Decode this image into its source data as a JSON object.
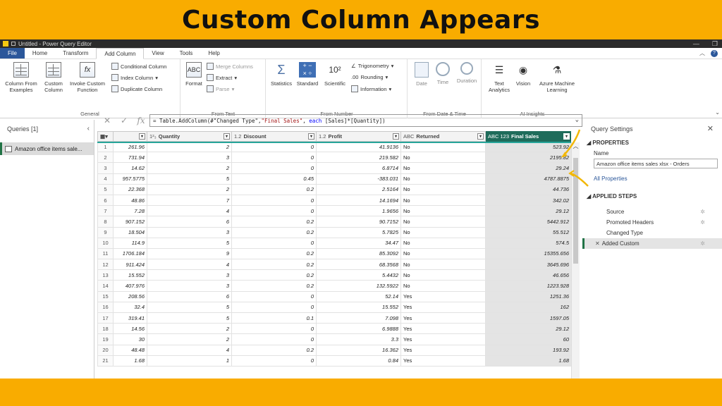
{
  "banner": {
    "title": "Custom Column Appears"
  },
  "window": {
    "title": "Untitled - Power Query Editor"
  },
  "menu": {
    "tabs": [
      "File",
      "Home",
      "Transform",
      "Add Column",
      "View",
      "Tools",
      "Help"
    ],
    "active": "Add Column"
  },
  "ribbon": {
    "general": {
      "label": "General",
      "column_from_examples": "Column From Examples",
      "custom_column": "Custom Column",
      "invoke_custom_function": "Invoke Custom Function",
      "conditional_column": "Conditional Column",
      "index_column": "Index Column",
      "duplicate_column": "Duplicate Column"
    },
    "from_text": {
      "label": "From Text",
      "format": "Format",
      "merge_columns": "Merge Columns",
      "extract": "Extract",
      "parse": "Parse"
    },
    "from_number": {
      "label": "From Number",
      "statistics": "Statistics",
      "standard": "Standard",
      "scientific": "Scientific",
      "trigonometry": "Trigonometry",
      "rounding": "Rounding",
      "information": "Information"
    },
    "from_date_time": {
      "label": "From Date & Time",
      "date": "Date",
      "time": "Time",
      "duration": "Duration"
    },
    "ai_insights": {
      "label": "AI Insights",
      "text_analytics": "Text Analytics",
      "vision": "Vision",
      "azure_ml": "Azure Machine Learning"
    }
  },
  "queries": {
    "header": "Queries [1]",
    "items": [
      "Amazon office items sale..."
    ]
  },
  "formula": {
    "prefix": "= Table.AddColumn(#\"Changed Type\", ",
    "str": "\"Final Sales\"",
    "mid": ", ",
    "kw": "each",
    "suffix": " [Sales]*[Quantity])"
  },
  "table": {
    "columns": [
      {
        "type": "",
        "name": ""
      },
      {
        "type": "1²₃",
        "name": "Quantity"
      },
      {
        "type": "1.2",
        "name": "Discount"
      },
      {
        "type": "1.2",
        "name": "Profit"
      },
      {
        "type": "ABC",
        "name": "Returned"
      },
      {
        "type": "ABC 123",
        "name": "Final Sales"
      }
    ],
    "rows": [
      [
        "1",
        "261.96",
        "2",
        "0",
        "41.9136",
        "No",
        "523.92"
      ],
      [
        "2",
        "731.94",
        "3",
        "0",
        "219.582",
        "No",
        "2195.82"
      ],
      [
        "3",
        "14.62",
        "2",
        "0",
        "6.8714",
        "No",
        "29.24"
      ],
      [
        "4",
        "957.5775",
        "5",
        "0.45",
        "-383.031",
        "No",
        "4787.8875"
      ],
      [
        "5",
        "22.368",
        "2",
        "0.2",
        "2.5164",
        "No",
        "44.736"
      ],
      [
        "6",
        "48.86",
        "7",
        "0",
        "14.1694",
        "No",
        "342.02"
      ],
      [
        "7",
        "7.28",
        "4",
        "0",
        "1.9656",
        "No",
        "29.12"
      ],
      [
        "8",
        "907.152",
        "6",
        "0.2",
        "90.7152",
        "No",
        "5442.912"
      ],
      [
        "9",
        "18.504",
        "3",
        "0.2",
        "5.7825",
        "No",
        "55.512"
      ],
      [
        "10",
        "114.9",
        "5",
        "0",
        "34.47",
        "No",
        "574.5"
      ],
      [
        "11",
        "1706.184",
        "9",
        "0.2",
        "85.3092",
        "No",
        "15355.656"
      ],
      [
        "12",
        "911.424",
        "4",
        "0.2",
        "68.3568",
        "No",
        "3645.696"
      ],
      [
        "13",
        "15.552",
        "3",
        "0.2",
        "5.4432",
        "No",
        "46.656"
      ],
      [
        "14",
        "407.976",
        "3",
        "0.2",
        "132.5922",
        "No",
        "1223.928"
      ],
      [
        "15",
        "208.56",
        "6",
        "0",
        "52.14",
        "Yes",
        "1251.36"
      ],
      [
        "16",
        "32.4",
        "5",
        "0",
        "15.552",
        "Yes",
        "162"
      ],
      [
        "17",
        "319.41",
        "5",
        "0.1",
        "7.098",
        "Yes",
        "1597.05"
      ],
      [
        "18",
        "14.56",
        "2",
        "0",
        "6.9888",
        "Yes",
        "29.12"
      ],
      [
        "19",
        "30",
        "2",
        "0",
        "3.3",
        "Yes",
        "60"
      ],
      [
        "20",
        "48.48",
        "4",
        "0.2",
        "16.362",
        "Yes",
        "193.92"
      ],
      [
        "21",
        "1.68",
        "1",
        "0",
        "0.84",
        "Yes",
        "1.68"
      ]
    ]
  },
  "settings": {
    "title": "Query Settings",
    "properties": "PROPERTIES",
    "name_label": "Name",
    "name_value": "Amazon office items sales xlsx - Orders",
    "all_properties": "All Properties",
    "applied_steps": "APPLIED STEPS",
    "steps": [
      "Source",
      "Promoted Headers",
      "Changed Type",
      "Added Custom"
    ]
  },
  "colors": {
    "banner": "#f9ac00",
    "selected_header": "#1f6c5b",
    "teal": "#27a59a",
    "file_tab": "#2b579a"
  }
}
